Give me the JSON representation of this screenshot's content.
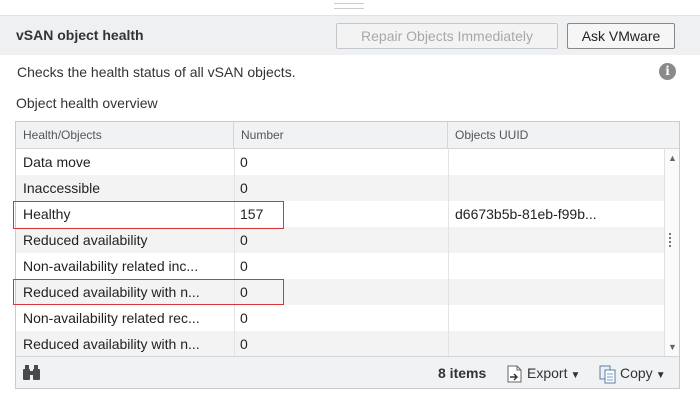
{
  "header": {
    "title": "vSAN object health",
    "repair_button": "Repair Objects Immediately",
    "ask_button": "Ask VMware"
  },
  "description": "Checks the health status of all vSAN objects.",
  "section_label": "Object health overview",
  "table": {
    "columns": [
      "Health/Objects",
      "Number",
      "Objects UUID"
    ],
    "rows": [
      {
        "health": "Data move",
        "number": "0",
        "uuid": ""
      },
      {
        "health": "Inaccessible",
        "number": "0",
        "uuid": ""
      },
      {
        "health": "Healthy",
        "number": "157",
        "uuid": "d6673b5b-81eb-f99b..."
      },
      {
        "health": "Reduced availability",
        "number": "0",
        "uuid": ""
      },
      {
        "health": "Non-availability related inc...",
        "number": "0",
        "uuid": ""
      },
      {
        "health": "Reduced availability with n...",
        "number": "0",
        "uuid": ""
      },
      {
        "health": "Non-availability related rec...",
        "number": "0",
        "uuid": ""
      },
      {
        "health": "Reduced availability with n...",
        "number": "0",
        "uuid": ""
      }
    ]
  },
  "footer": {
    "item_count": "8 items",
    "export_label": "Export",
    "copy_label": "Copy"
  },
  "icons": {
    "info": "info-icon",
    "find": "binoculars-icon",
    "export": "export-icon",
    "copy": "copy-icon"
  },
  "colors": {
    "highlight": "#d9343a",
    "header_bg": "#eff0f2"
  }
}
